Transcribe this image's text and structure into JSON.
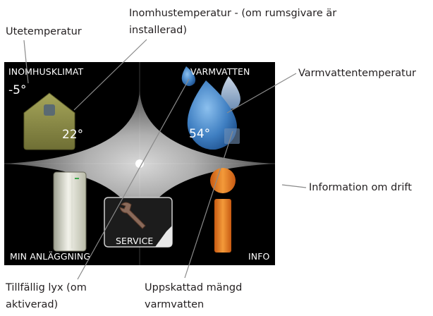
{
  "callouts": {
    "outdoor_temp": "Utetemperatur",
    "indoor_temp_line1": "Inomhustemperatur - (om rumsgivare är",
    "indoor_temp_line2": "installerad)",
    "hot_water_temp": "Varmvattentemperatur",
    "info_operation": "Information om drift",
    "temp_lux_line1": "Tillfällig lyx  (om",
    "temp_lux_line2": "aktiverad)",
    "est_hot_water_line1": "Uppskattad mängd",
    "est_hot_water_line2": "varmvatten"
  },
  "screen": {
    "indoor_climate": "INOMHUSKLIMAT",
    "hot_water": "VARMVATTEN",
    "my_system": "MIN ANLÄGGNING",
    "info": "INFO",
    "service": "SERVICE",
    "outdoor_value": "-5°",
    "indoor_value": "22°",
    "hot_water_value": "54°"
  },
  "colors": {
    "screen_bg": "#000000",
    "house": "#8f8f4a",
    "drop": "#4d8ccb",
    "info_orange": "#e8731f",
    "leader_line": "#8a8a8a"
  }
}
